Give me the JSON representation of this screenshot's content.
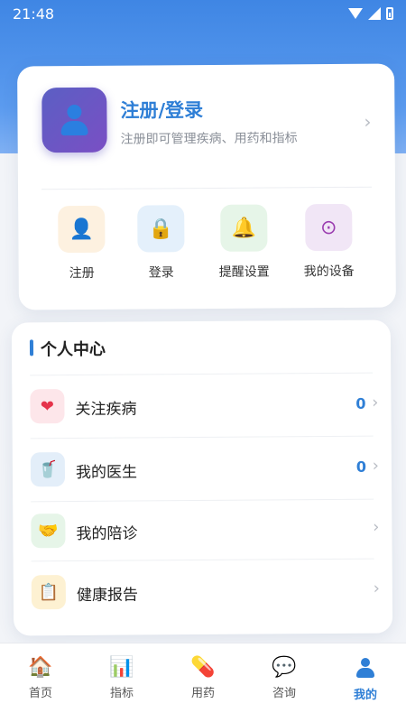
{
  "status": {
    "time": "21:48"
  },
  "profile": {
    "title": "注册/登录",
    "subtitle": "注册即可管理疾病、用药和指标",
    "chevron": "›"
  },
  "quick_actions": [
    {
      "label": "注册",
      "icon": "person-icon",
      "glyph": "👤",
      "bg": "#fdf1e0"
    },
    {
      "label": "登录",
      "icon": "lock-icon",
      "glyph": "🔒",
      "bg": "#e4f0fb"
    },
    {
      "label": "提醒设置",
      "icon": "bell-icon",
      "glyph": "🔔",
      "bg": "#e6f5e8"
    },
    {
      "label": "我的设备",
      "icon": "device-icon",
      "glyph": "⊙",
      "bg": "#f1e6f6"
    }
  ],
  "personal_center": {
    "title": "个人中心",
    "items": [
      {
        "label": "关注疾病",
        "count": "0",
        "icon": "heart-icon",
        "glyph": "❤",
        "bg": "#fde6ea",
        "color": "#e5334b"
      },
      {
        "label": "我的医生",
        "count": "0",
        "icon": "doctor-icon",
        "glyph": "🥤",
        "bg": "#e3eef9",
        "color": "#2f7fd6"
      },
      {
        "label": "我的陪诊",
        "count": "",
        "icon": "handshake-icon",
        "glyph": "🤝",
        "bg": "#e6f5e8",
        "color": "#e9a23b"
      },
      {
        "label": "健康报告",
        "count": "",
        "icon": "clipboard-icon",
        "glyph": "📋",
        "bg": "#fdf1d2",
        "color": "#a0722c"
      }
    ]
  },
  "tabs": [
    {
      "label": "首页",
      "icon": "home-icon",
      "glyph": "🏠"
    },
    {
      "label": "指标",
      "icon": "chart-icon",
      "glyph": "📊"
    },
    {
      "label": "用药",
      "icon": "pill-icon",
      "glyph": "💊"
    },
    {
      "label": "咨询",
      "icon": "chat-icon",
      "glyph": "💬"
    },
    {
      "label": "我的",
      "icon": "profile-icon",
      "glyph": "",
      "active": true
    }
  ],
  "colors": {
    "accent": "#2f7fd6",
    "header": "#3f86e4"
  }
}
